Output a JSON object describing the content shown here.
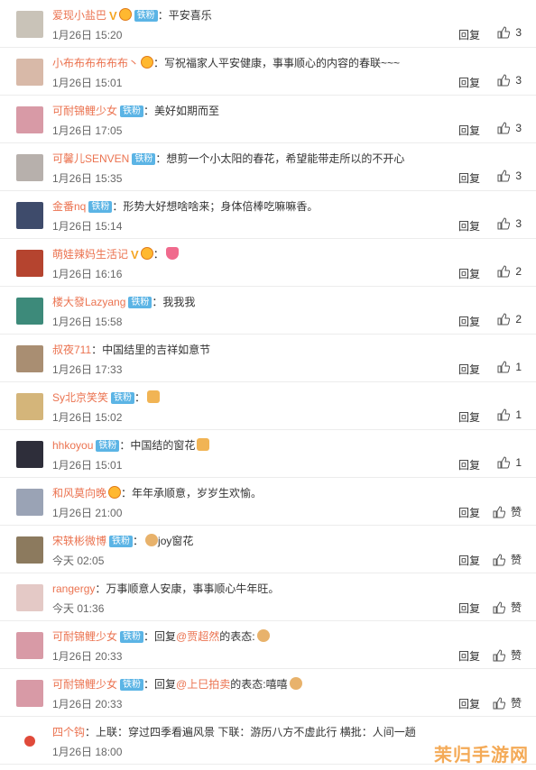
{
  "reply_label": "回复",
  "like_label": "赞",
  "watermark": "茉归手游网",
  "comments": [
    {
      "user": "爱现小盐巴",
      "vip": true,
      "medal": true,
      "badge": "铁粉",
      "text": "平安喜乐",
      "time": "1月26日 15:20",
      "likes": "3",
      "avatar": "#c9c3b8"
    },
    {
      "user": "小布布布布布布丶",
      "vip": false,
      "medal": true,
      "badge": "",
      "text": "写祝福家人平安健康，事事顺心的内容的春联~~~",
      "time": "1月26日 15:01",
      "likes": "3",
      "avatar": "#d8b9a8"
    },
    {
      "user": "可耐锦鲤少女",
      "vip": false,
      "medal": false,
      "badge": "铁粉",
      "text": "美好如期而至",
      "time": "1月26日 17:05",
      "likes": "3",
      "avatar": "#d89aa6"
    },
    {
      "user": "可馨儿SENVEN",
      "vip": false,
      "medal": false,
      "badge": "铁粉",
      "text": "想剪一个小太阳的春花，希望能带走所以的不开心",
      "time": "1月26日 15:35",
      "likes": "3",
      "avatar": "#b7b0ac"
    },
    {
      "user": "金番nq",
      "vip": false,
      "medal": false,
      "badge": "铁粉",
      "text": "形势大好想啥啥来；身体倍棒吃嘛嘛香。",
      "time": "1月26日 15:14",
      "likes": "3",
      "avatar": "#3e4b6b"
    },
    {
      "user": "萌娃辣妈生活记",
      "vip": true,
      "medal": true,
      "badge": "",
      "text": "",
      "emoji": "heart",
      "time": "1月26日 16:16",
      "likes": "2",
      "avatar": "#b5442f"
    },
    {
      "user": "楼大發Lazyang",
      "vip": false,
      "medal": false,
      "badge": "铁粉",
      "text": "我我我",
      "time": "1月26日 15:58",
      "likes": "2",
      "avatar": "#3d8a7a"
    },
    {
      "user": "叔夜711",
      "vip": false,
      "medal": false,
      "badge": "",
      "text": "中国结里的吉祥如意节",
      "time": "1月26日 17:33",
      "likes": "1",
      "avatar": "#a98e72"
    },
    {
      "user": "Sy北京笑笑",
      "vip": false,
      "medal": false,
      "badge": "铁粉",
      "text": "",
      "emoji": "bread",
      "time": "1月26日 15:02",
      "likes": "1",
      "avatar": "#d4b57a"
    },
    {
      "user": "hhkoyou",
      "vip": false,
      "medal": false,
      "badge": "铁粉",
      "text": "中国结的窗花",
      "emoji": "bread",
      "time": "1月26日 15:01",
      "likes": "1",
      "avatar": "#2e2e3a"
    },
    {
      "user": "和风莫向晚",
      "vip": false,
      "medal": true,
      "badge": "",
      "text": "年年承顺意，岁岁生欢愉。",
      "time": "1月26日 21:00",
      "likes": "赞",
      "avatar": "#9aa3b5"
    },
    {
      "user": "宋轶彬微博",
      "vip": false,
      "medal": false,
      "badge": "铁粉",
      "text": "joy窗花",
      "emoji_before": "dog",
      "time": "今天 02:05",
      "likes": "赞",
      "avatar": "#8c7a5e"
    },
    {
      "user": "rangergy",
      "vip": false,
      "medal": false,
      "badge": "",
      "text": "万事顺意人安康，事事顺心牛年旺。",
      "time": "今天 01:36",
      "likes": "赞",
      "avatar": "#e4c9c6"
    },
    {
      "user": "可耐锦鲤少女",
      "vip": false,
      "medal": false,
      "badge": "铁粉",
      "text": "回复",
      "at": "@贾超然",
      "tail": "的表态:",
      "emoji": "dog",
      "time": "1月26日 20:33",
      "likes": "赞",
      "avatar": "#d89aa6"
    },
    {
      "user": "可耐锦鲤少女",
      "vip": false,
      "medal": false,
      "badge": "铁粉",
      "text": "回复",
      "at": "@上巳拍卖",
      "tail": "的表态:嘻嘻",
      "emoji": "dog",
      "time": "1月26日 20:33",
      "likes": "赞",
      "avatar": "#d89aa6"
    },
    {
      "user": "四个钩",
      "vip": false,
      "medal": false,
      "badge": "",
      "text": "上联：穿过四季看遍风景 下联：游历八方不虚此行 横批：人间一趟",
      "time": "1月26日 18:00",
      "likes": "",
      "avatar": "#ffffff"
    }
  ]
}
